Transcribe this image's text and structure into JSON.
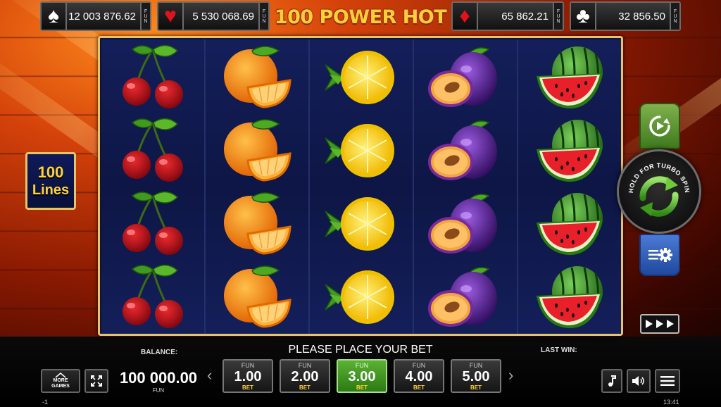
{
  "jackpots": [
    {
      "suit": "spade",
      "symbol": "♠",
      "value": "12 003 876.62",
      "currency": "FUN",
      "color": "#ffffff"
    },
    {
      "suit": "heart",
      "symbol": "♥",
      "value": "5 530 068.69",
      "currency": "FUN",
      "color": "#e0131d"
    },
    {
      "suit": "diamond",
      "symbol": "♦",
      "value": "65 862.21",
      "currency": "FUN",
      "color": "#e0131d"
    },
    {
      "suit": "club",
      "symbol": "♣",
      "value": "32 856.50",
      "currency": "FUN",
      "color": "#ffffff"
    }
  ],
  "game_title": "100 POWER HOT",
  "lines_badge": {
    "number": "100",
    "label": "Lines"
  },
  "reels": [
    [
      "cherry",
      "cherry",
      "cherry",
      "cherry"
    ],
    [
      "orange",
      "orange",
      "orange",
      "orange"
    ],
    [
      "lemon",
      "lemon",
      "lemon",
      "lemon"
    ],
    [
      "plum",
      "plum",
      "plum",
      "plum"
    ],
    [
      "watermelon",
      "watermelon",
      "watermelon",
      "watermelon"
    ]
  ],
  "controls": {
    "autoplay_icon": "play-circle-icon",
    "spin_icon": "refresh-arrows-icon",
    "spin_hint": "HOLD FOR TURBO SPIN",
    "settings_icon": "gear-icon",
    "fast_icon": "fast-forward-icon"
  },
  "bottom": {
    "balance_label": "BALANCE:",
    "balance_value": "100 000.00",
    "balance_currency": "FUN",
    "message": "PLEASE PLACE YOUR BET",
    "last_win_label": "LAST WIN:",
    "more_games_line1": "MORE",
    "more_games_line2": "GAMES",
    "bets": [
      {
        "currency": "FUN",
        "value": "1.00",
        "label": "BET",
        "selected": false
      },
      {
        "currency": "FUN",
        "value": "2.00",
        "label": "BET",
        "selected": false
      },
      {
        "currency": "FUN",
        "value": "3.00",
        "label": "BET",
        "selected": true
      },
      {
        "currency": "FUN",
        "value": "4.00",
        "label": "BET",
        "selected": false
      },
      {
        "currency": "FUN",
        "value": "5.00",
        "label": "BET",
        "selected": false
      }
    ],
    "prev_arrow": "‹",
    "next_arrow": "›"
  },
  "status": {
    "left": "-1",
    "time": "13:41"
  },
  "colors": {
    "gold": "#ffcf3a",
    "frame": "#e7c36a",
    "reel_bg": "#0d1645",
    "active_bet": "#3f9a20"
  }
}
